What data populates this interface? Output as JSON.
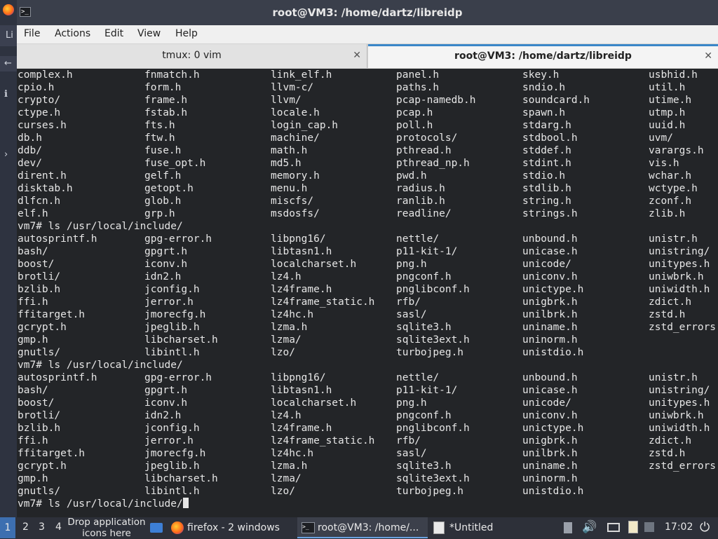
{
  "window": {
    "title": "root@VM3: /home/dartz/libreidp"
  },
  "menu": [
    "File",
    "Actions",
    "Edit",
    "View",
    "Help"
  ],
  "tabs": [
    {
      "label": "tmux: 0 vim"
    },
    {
      "label": "root@VM3: /home/dartz/libreidp"
    }
  ],
  "desktop_stub": {
    "label1": "Li",
    "label2": "←",
    "label3": "ℹ",
    "label4": "›"
  },
  "terminal": {
    "lines": [
      [
        "complex.h",
        "fnmatch.h",
        "link_elf.h",
        "panel.h",
        "skey.h",
        "usbhid.h"
      ],
      [
        "cpio.h",
        "form.h",
        "llvm-c/",
        "paths.h",
        "sndio.h",
        "util.h"
      ],
      [
        "crypto/",
        "frame.h",
        "llvm/",
        "pcap-namedb.h",
        "soundcard.h",
        "utime.h"
      ],
      [
        "ctype.h",
        "fstab.h",
        "locale.h",
        "pcap.h",
        "spawn.h",
        "utmp.h"
      ],
      [
        "curses.h",
        "fts.h",
        "login_cap.h",
        "poll.h",
        "stdarg.h",
        "uuid.h"
      ],
      [
        "db.h",
        "ftw.h",
        "machine/",
        "protocols/",
        "stdbool.h",
        "uvm/"
      ],
      [
        "ddb/",
        "fuse.h",
        "math.h",
        "pthread.h",
        "stddef.h",
        "varargs.h"
      ],
      [
        "dev/",
        "fuse_opt.h",
        "md5.h",
        "pthread_np.h",
        "stdint.h",
        "vis.h"
      ],
      [
        "dirent.h",
        "gelf.h",
        "memory.h",
        "pwd.h",
        "stdio.h",
        "wchar.h"
      ],
      [
        "disktab.h",
        "getopt.h",
        "menu.h",
        "radius.h",
        "stdlib.h",
        "wctype.h"
      ],
      [
        "dlfcn.h",
        "glob.h",
        "miscfs/",
        "ranlib.h",
        "string.h",
        "zconf.h"
      ],
      [
        "elf.h",
        "grp.h",
        "msdosfs/",
        "readline/",
        "strings.h",
        "zlib.h"
      ],
      [
        "vm7# ls /usr/local/include/"
      ],
      [
        "autosprintf.h",
        "gpg-error.h",
        "libpng16/",
        "nettle/",
        "unbound.h",
        "unistr.h"
      ],
      [
        "bash/",
        "gpgrt.h",
        "libtasn1.h",
        "p11-kit-1/",
        "unicase.h",
        "unistring/"
      ],
      [
        "boost/",
        "iconv.h",
        "localcharset.h",
        "png.h",
        "unicode/",
        "unitypes.h"
      ],
      [
        "brotli/",
        "idn2.h",
        "lz4.h",
        "pngconf.h",
        "uniconv.h",
        "uniwbrk.h"
      ],
      [
        "bzlib.h",
        "jconfig.h",
        "lz4frame.h",
        "pnglibconf.h",
        "unictype.h",
        "uniwidth.h"
      ],
      [
        "ffi.h",
        "jerror.h",
        "lz4frame_static.h",
        "rfb/",
        "unigbrk.h",
        "zdict.h"
      ],
      [
        "ffitarget.h",
        "jmorecfg.h",
        "lz4hc.h",
        "sasl/",
        "unilbrk.h",
        "zstd.h"
      ],
      [
        "gcrypt.h",
        "jpeglib.h",
        "lzma.h",
        "sqlite3.h",
        "uniname.h",
        "zstd_errors"
      ],
      [
        "gmp.h",
        "libcharset.h",
        "lzma/",
        "sqlite3ext.h",
        "uninorm.h",
        ""
      ],
      [
        "gnutls/",
        "libintl.h",
        "lzo/",
        "turbojpeg.h",
        "unistdio.h",
        ""
      ],
      [
        "vm7# ls /usr/local/include/"
      ],
      [
        "autosprintf.h",
        "gpg-error.h",
        "libpng16/",
        "nettle/",
        "unbound.h",
        "unistr.h"
      ],
      [
        "bash/",
        "gpgrt.h",
        "libtasn1.h",
        "p11-kit-1/",
        "unicase.h",
        "unistring/"
      ],
      [
        "boost/",
        "iconv.h",
        "localcharset.h",
        "png.h",
        "unicode/",
        "unitypes.h"
      ],
      [
        "brotli/",
        "idn2.h",
        "lz4.h",
        "pngconf.h",
        "uniconv.h",
        "uniwbrk.h"
      ],
      [
        "bzlib.h",
        "jconfig.h",
        "lz4frame.h",
        "pnglibconf.h",
        "unictype.h",
        "uniwidth.h"
      ],
      [
        "ffi.h",
        "jerror.h",
        "lz4frame_static.h",
        "rfb/",
        "unigbrk.h",
        "zdict.h"
      ],
      [
        "ffitarget.h",
        "jmorecfg.h",
        "lz4hc.h",
        "sasl/",
        "unilbrk.h",
        "zstd.h"
      ],
      [
        "gcrypt.h",
        "jpeglib.h",
        "lzma.h",
        "sqlite3.h",
        "uniname.h",
        "zstd_errors"
      ],
      [
        "gmp.h",
        "libcharset.h",
        "lzma/",
        "sqlite3ext.h",
        "uninorm.h",
        ""
      ],
      [
        "gnutls/",
        "libintl.h",
        "lzo/",
        "turbojpeg.h",
        "unistdio.h",
        ""
      ]
    ],
    "prompt": "vm7# ls /usr/local/include/"
  },
  "taskbar": {
    "workspaces": [
      "1",
      "2",
      "3",
      "4"
    ],
    "drop_label": "Drop application icons here",
    "items": [
      {
        "label": "firefox - 2 windows"
      },
      {
        "label": "root@VM3: /home/..."
      },
      {
        "label": "*Untitled"
      }
    ],
    "clock": "17:02"
  },
  "colors": {
    "terminal_bg": "#232528",
    "terminal_fg": "#e6e6e6",
    "accent": "#3d6fb0"
  }
}
